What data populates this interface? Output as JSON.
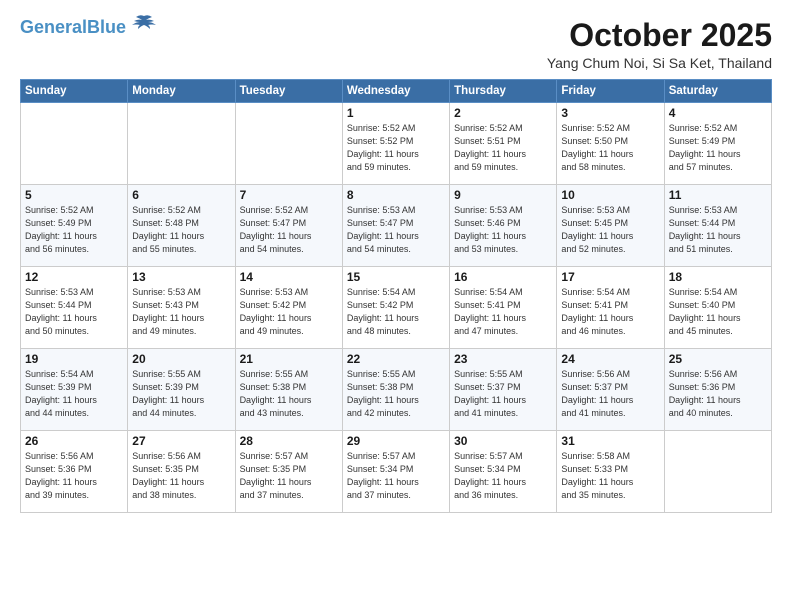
{
  "header": {
    "logo_line1": "General",
    "logo_line2": "Blue",
    "month": "October 2025",
    "location": "Yang Chum Noi, Si Sa Ket, Thailand"
  },
  "days_of_week": [
    "Sunday",
    "Monday",
    "Tuesday",
    "Wednesday",
    "Thursday",
    "Friday",
    "Saturday"
  ],
  "weeks": [
    [
      {
        "day": "",
        "info": ""
      },
      {
        "day": "",
        "info": ""
      },
      {
        "day": "",
        "info": ""
      },
      {
        "day": "1",
        "info": "Sunrise: 5:52 AM\nSunset: 5:52 PM\nDaylight: 11 hours\nand 59 minutes."
      },
      {
        "day": "2",
        "info": "Sunrise: 5:52 AM\nSunset: 5:51 PM\nDaylight: 11 hours\nand 59 minutes."
      },
      {
        "day": "3",
        "info": "Sunrise: 5:52 AM\nSunset: 5:50 PM\nDaylight: 11 hours\nand 58 minutes."
      },
      {
        "day": "4",
        "info": "Sunrise: 5:52 AM\nSunset: 5:49 PM\nDaylight: 11 hours\nand 57 minutes."
      }
    ],
    [
      {
        "day": "5",
        "info": "Sunrise: 5:52 AM\nSunset: 5:49 PM\nDaylight: 11 hours\nand 56 minutes."
      },
      {
        "day": "6",
        "info": "Sunrise: 5:52 AM\nSunset: 5:48 PM\nDaylight: 11 hours\nand 55 minutes."
      },
      {
        "day": "7",
        "info": "Sunrise: 5:52 AM\nSunset: 5:47 PM\nDaylight: 11 hours\nand 54 minutes."
      },
      {
        "day": "8",
        "info": "Sunrise: 5:53 AM\nSunset: 5:47 PM\nDaylight: 11 hours\nand 54 minutes."
      },
      {
        "day": "9",
        "info": "Sunrise: 5:53 AM\nSunset: 5:46 PM\nDaylight: 11 hours\nand 53 minutes."
      },
      {
        "day": "10",
        "info": "Sunrise: 5:53 AM\nSunset: 5:45 PM\nDaylight: 11 hours\nand 52 minutes."
      },
      {
        "day": "11",
        "info": "Sunrise: 5:53 AM\nSunset: 5:44 PM\nDaylight: 11 hours\nand 51 minutes."
      }
    ],
    [
      {
        "day": "12",
        "info": "Sunrise: 5:53 AM\nSunset: 5:44 PM\nDaylight: 11 hours\nand 50 minutes."
      },
      {
        "day": "13",
        "info": "Sunrise: 5:53 AM\nSunset: 5:43 PM\nDaylight: 11 hours\nand 49 minutes."
      },
      {
        "day": "14",
        "info": "Sunrise: 5:53 AM\nSunset: 5:42 PM\nDaylight: 11 hours\nand 49 minutes."
      },
      {
        "day": "15",
        "info": "Sunrise: 5:54 AM\nSunset: 5:42 PM\nDaylight: 11 hours\nand 48 minutes."
      },
      {
        "day": "16",
        "info": "Sunrise: 5:54 AM\nSunset: 5:41 PM\nDaylight: 11 hours\nand 47 minutes."
      },
      {
        "day": "17",
        "info": "Sunrise: 5:54 AM\nSunset: 5:41 PM\nDaylight: 11 hours\nand 46 minutes."
      },
      {
        "day": "18",
        "info": "Sunrise: 5:54 AM\nSunset: 5:40 PM\nDaylight: 11 hours\nand 45 minutes."
      }
    ],
    [
      {
        "day": "19",
        "info": "Sunrise: 5:54 AM\nSunset: 5:39 PM\nDaylight: 11 hours\nand 44 minutes."
      },
      {
        "day": "20",
        "info": "Sunrise: 5:55 AM\nSunset: 5:39 PM\nDaylight: 11 hours\nand 44 minutes."
      },
      {
        "day": "21",
        "info": "Sunrise: 5:55 AM\nSunset: 5:38 PM\nDaylight: 11 hours\nand 43 minutes."
      },
      {
        "day": "22",
        "info": "Sunrise: 5:55 AM\nSunset: 5:38 PM\nDaylight: 11 hours\nand 42 minutes."
      },
      {
        "day": "23",
        "info": "Sunrise: 5:55 AM\nSunset: 5:37 PM\nDaylight: 11 hours\nand 41 minutes."
      },
      {
        "day": "24",
        "info": "Sunrise: 5:56 AM\nSunset: 5:37 PM\nDaylight: 11 hours\nand 41 minutes."
      },
      {
        "day": "25",
        "info": "Sunrise: 5:56 AM\nSunset: 5:36 PM\nDaylight: 11 hours\nand 40 minutes."
      }
    ],
    [
      {
        "day": "26",
        "info": "Sunrise: 5:56 AM\nSunset: 5:36 PM\nDaylight: 11 hours\nand 39 minutes."
      },
      {
        "day": "27",
        "info": "Sunrise: 5:56 AM\nSunset: 5:35 PM\nDaylight: 11 hours\nand 38 minutes."
      },
      {
        "day": "28",
        "info": "Sunrise: 5:57 AM\nSunset: 5:35 PM\nDaylight: 11 hours\nand 37 minutes."
      },
      {
        "day": "29",
        "info": "Sunrise: 5:57 AM\nSunset: 5:34 PM\nDaylight: 11 hours\nand 37 minutes."
      },
      {
        "day": "30",
        "info": "Sunrise: 5:57 AM\nSunset: 5:34 PM\nDaylight: 11 hours\nand 36 minutes."
      },
      {
        "day": "31",
        "info": "Sunrise: 5:58 AM\nSunset: 5:33 PM\nDaylight: 11 hours\nand 35 minutes."
      },
      {
        "day": "",
        "info": ""
      }
    ]
  ]
}
